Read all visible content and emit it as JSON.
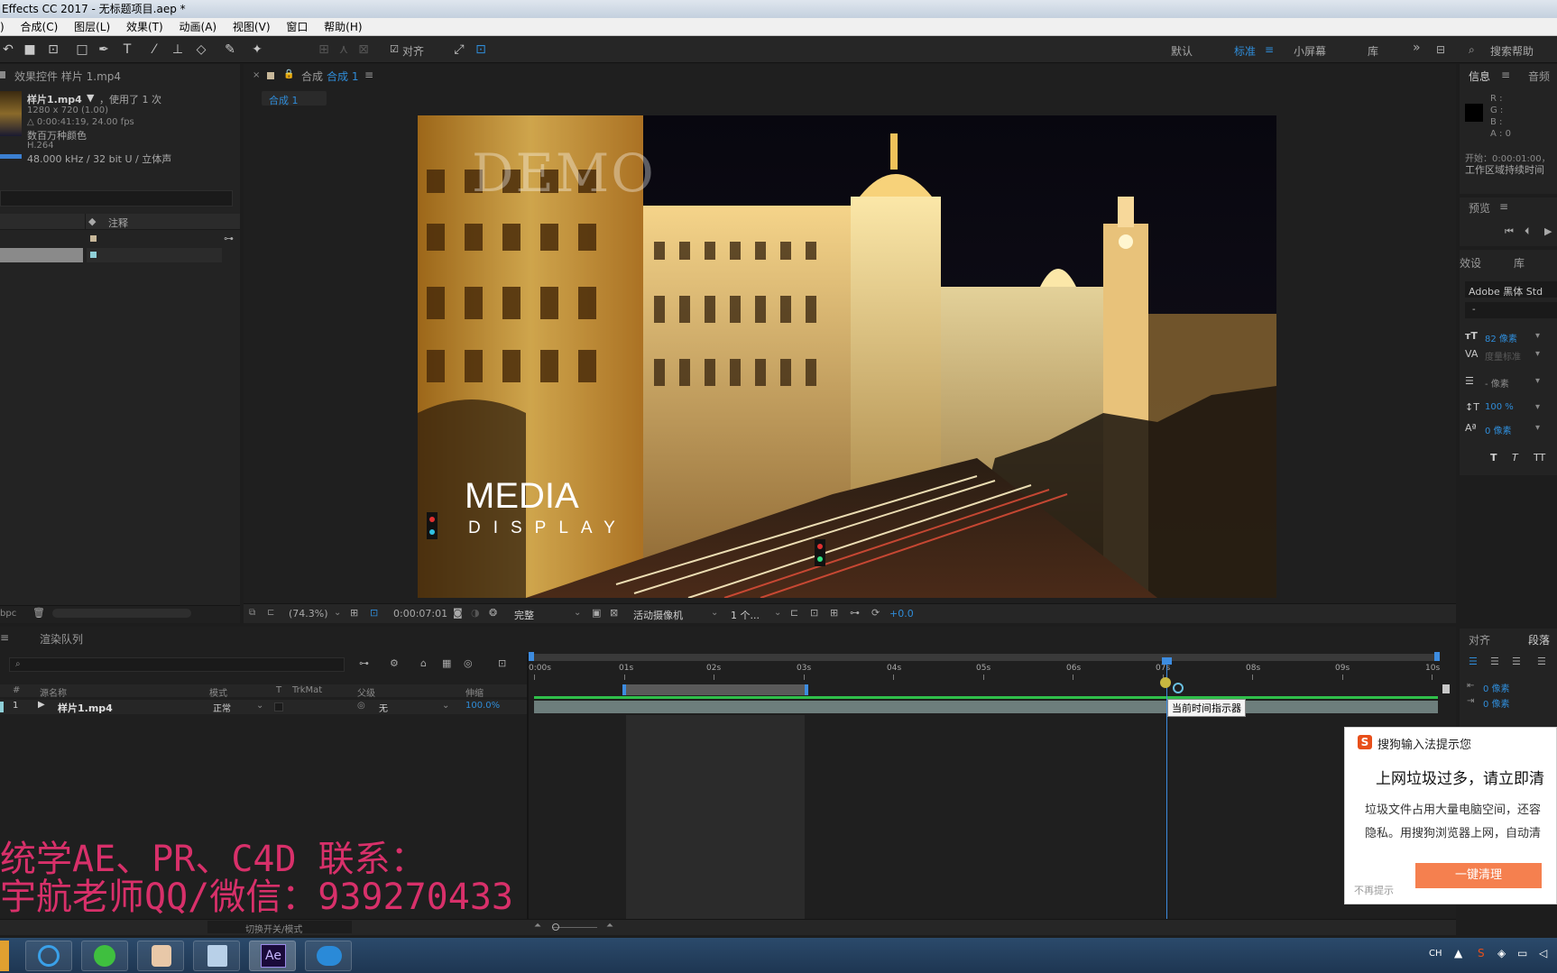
{
  "window": {
    "title": "Effects CC 2017 - 无标题项目.aep *"
  },
  "menu": [
    "合成(C)",
    "图层(L)",
    "效果(T)",
    "动画(A)",
    "视图(V)",
    "窗口",
    "帮助(H)"
  ],
  "toolbar": {
    "snap_label": "对齐",
    "workspaces": [
      "默认",
      "标准",
      "小屏幕",
      "库"
    ],
    "active_workspace": "标准",
    "search_placeholder": "搜索帮助"
  },
  "effects_panel": {
    "tab": "效果控件 样片 1.mp4",
    "file_name": "样片1.mp4",
    "usage": "，使用了 1 次",
    "resolution": "1280 x 720 (1.00)",
    "duration": "△ 0:00:41:19, 24.00 fps",
    "colors": "数百万种颜色",
    "codec": "H.264",
    "audio": "48.000 kHz / 32 bit U / 立体声",
    "col_comment": "注释",
    "bpc": "bpc"
  },
  "comp_panel": {
    "tab_prefix": "合成",
    "tab_name": "合成 1",
    "sub_tab": "合成 1",
    "watermark": "DEMO",
    "title_big": "MEDIA",
    "title_small": "DISPLAY",
    "zoom": "(74.3%)",
    "timecode": "0:00:07:01",
    "resolution": "完整",
    "camera": "活动摄像机",
    "views": "1 个...",
    "exposure": "+0.0"
  },
  "info_panel": {
    "tab_info": "信息",
    "tab_audio": "音频",
    "r": "R :",
    "g": "G :",
    "b": "B :",
    "a": "A : 0",
    "start": "开始：0:00:01:00，",
    "note": "工作区域持续时间"
  },
  "preview_panel": {
    "tab": "预览"
  },
  "character_panel": {
    "tab_presets": "效设",
    "tab_library": "库",
    "font": "Adobe 黑体 Std",
    "style": "-",
    "size": "82 像素",
    "tracking": "度量标准",
    "leading": "- 像素",
    "vscale": "100 %",
    "baseline": "0 像素",
    "styles": [
      "T",
      "T",
      "TT"
    ]
  },
  "para_panel": {
    "tab_align": "对齐",
    "tab_para": "段落",
    "indent1": "0 像素",
    "indent2": "0 像素"
  },
  "timeline": {
    "tab_render": "渲染队列",
    "columns": {
      "num": "#",
      "name": "源名称",
      "mode": "模式",
      "t": "T",
      "trkmat": "TrkMat",
      "parent": "父级",
      "stretch": "伸缩"
    },
    "layer": {
      "num": "1",
      "name": "样片1.mp4",
      "mode": "正常",
      "parent": "无",
      "stretch": "100.0%"
    },
    "ruler": [
      "0:00s",
      "01s",
      "02s",
      "03s",
      "04s",
      "05s",
      "06s",
      "07s",
      "08s",
      "09s",
      "10s"
    ],
    "tooltip": "当前时间指示器",
    "toggle": "切换开关/模式"
  },
  "overlay_text": {
    "line1": "统学AE、PR、C4D 联系：",
    "line2": "宇航老师QQ/微信：939270433"
  },
  "popup": {
    "header": "搜狗输入法提示您",
    "title": "上网垃圾过多，请立即清",
    "body1": "垃圾文件占用大量电脑空间，还容",
    "body2": "隐私。用搜狗浏览器上网，自动清",
    "dismiss": "不再提示",
    "button": "一键清理"
  },
  "taskbar": {
    "tray_lang": "CH",
    "apps": [
      "app-icon",
      "browser-icon",
      "user-icon",
      "notes-icon",
      "after-effects-icon",
      "media-icon"
    ],
    "ae_label": "Ae"
  },
  "colors": {
    "accent": "#2f8cd8",
    "overlay_text": "#d8306a",
    "popup_button": "#f5804f",
    "timeline_bar": "#6d7e7c",
    "work_area": "#3d8ce0"
  }
}
